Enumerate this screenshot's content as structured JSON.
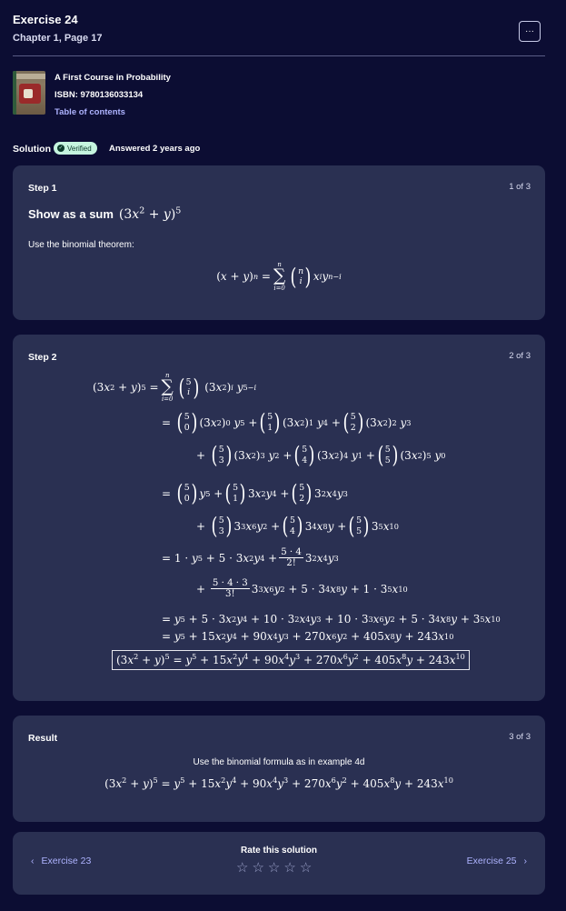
{
  "header": {
    "title": "Exercise 24",
    "subtitle": "Chapter 1, Page 17",
    "more_icon": "more-horizontal-icon",
    "more_label": "···"
  },
  "book": {
    "title": "A First Course in Probability",
    "isbn": "ISBN: 9780136033134",
    "toc_link": "Table of contents"
  },
  "solution": {
    "label": "Solution",
    "verified": "Verified",
    "answered": "Answered 2 years ago"
  },
  "steps": [
    {
      "label": "Step 1",
      "count": "1 of 3",
      "title": "Show as a sum",
      "desc": "Use the binomial theorem:"
    },
    {
      "label": "Step 2",
      "count": "2 of 3"
    },
    {
      "label": "Result",
      "count": "3 of 3",
      "desc": "Use the binomial formula as in example 4d"
    }
  ],
  "footer": {
    "prev": "Exercise 23",
    "next": "Exercise 25",
    "rate_label": "Rate this solution",
    "stars_total": 5
  },
  "colors": {
    "background": "#0c0d33",
    "card": "#2a3052",
    "link": "#aeb3ff",
    "verified_bg": "#c5f5df"
  }
}
